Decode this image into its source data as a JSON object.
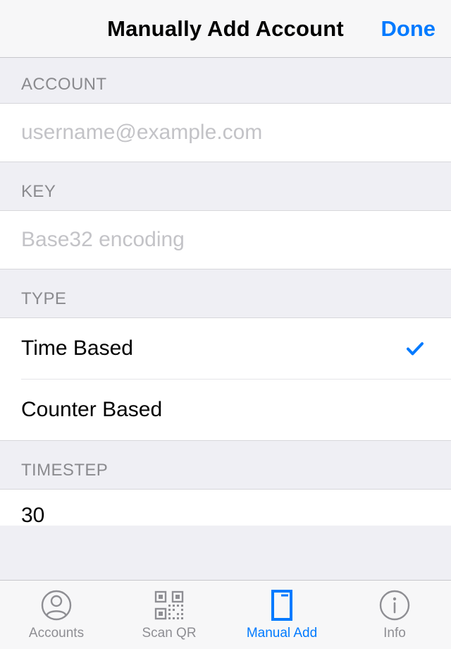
{
  "nav": {
    "title": "Manually Add Account",
    "done": "Done"
  },
  "sections": {
    "account": {
      "header": "ACCOUNT",
      "placeholder": "username@example.com",
      "value": ""
    },
    "key": {
      "header": "KEY",
      "placeholder": "Base32 encoding",
      "value": ""
    },
    "type": {
      "header": "TYPE",
      "options": [
        {
          "label": "Time Based",
          "selected": true
        },
        {
          "label": "Counter Based",
          "selected": false
        }
      ]
    },
    "timestep": {
      "header": "TIMESTEP",
      "value": "30"
    }
  },
  "tabs": [
    {
      "id": "accounts",
      "label": "Accounts",
      "active": false
    },
    {
      "id": "scanqr",
      "label": "Scan QR",
      "active": false
    },
    {
      "id": "manual",
      "label": "Manual Add",
      "active": true
    },
    {
      "id": "info",
      "label": "Info",
      "active": false
    }
  ],
  "colors": {
    "tint": "#007aff",
    "inactive": "#8e8e93"
  }
}
